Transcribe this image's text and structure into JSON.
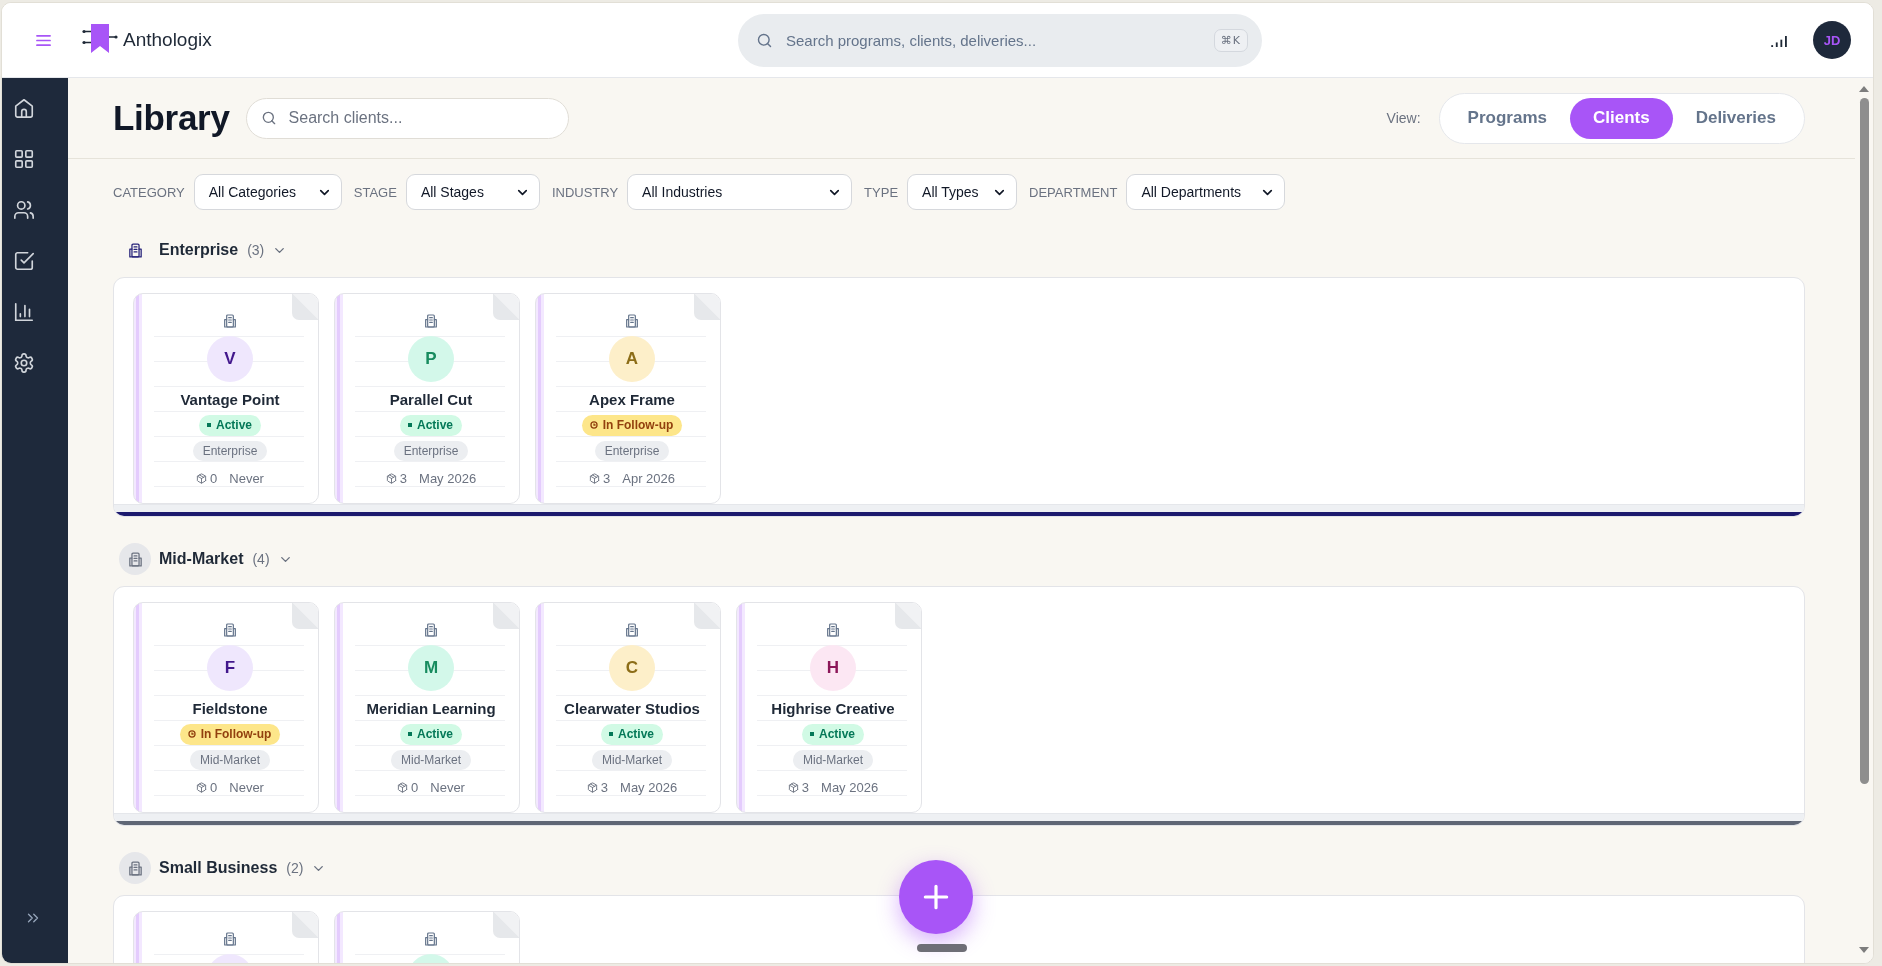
{
  "top_bar": {
    "brand": "Anthologix",
    "search": {
      "placeholder": "Search programs, clients, deliveries...",
      "shortcut": "⌘K"
    },
    "user": {
      "initials": "JD"
    }
  },
  "header": {
    "title": "Library",
    "search": {
      "placeholder": "Search clients..."
    },
    "view_label": "View:",
    "views": [
      {
        "label": "Programs",
        "selected": false
      },
      {
        "label": "Clients",
        "selected": true
      },
      {
        "label": "Deliveries",
        "selected": false
      }
    ]
  },
  "filters": [
    {
      "label": "CATEGORY",
      "value": "All Categories"
    },
    {
      "label": "STAGE",
      "value": "All Stages"
    },
    {
      "label": "INDUSTRY",
      "value": "All Industries"
    },
    {
      "label": "TYPE",
      "value": "All Types"
    },
    {
      "label": "DEPARTMENT",
      "value": "All Departments"
    }
  ],
  "groups": [
    {
      "name": "Enterprise",
      "count": "(3)",
      "selected": true,
      "expanded": true,
      "clients": [
        {
          "initial": "V",
          "color": "#efe7fd",
          "name": "Vantage Point",
          "status": {
            "label": "Active",
            "kind": "active"
          },
          "category": "Enterprise",
          "count": "0",
          "date": "Never"
        },
        {
          "initial": "P",
          "color": "#d3f8ea",
          "name": "Parallel Cut",
          "status": {
            "label": "Active",
            "kind": "active"
          },
          "category": "Enterprise",
          "count": "3",
          "date": "May 2026"
        },
        {
          "initial": "A",
          "color": "#fdefc9",
          "name": "Apex Frame",
          "status": {
            "label": "In Follow-up",
            "kind": "follow-up"
          },
          "category": "Enterprise",
          "count": "3",
          "date": "Apr 2026"
        }
      ]
    },
    {
      "name": "Mid-Market",
      "count": "(4)",
      "selected": false,
      "expanded": true,
      "clients": [
        {
          "initial": "F",
          "color": "#efe7fd",
          "name": "Fieldstone",
          "status": {
            "label": "In Follow-up",
            "kind": "follow-up"
          },
          "category": "Mid-Market",
          "count": "0",
          "date": "Never"
        },
        {
          "initial": "M",
          "color": "#d3f8ea",
          "name": "Meridian Learning",
          "status": {
            "label": "Active",
            "kind": "active"
          },
          "category": "Mid-Market",
          "count": "0",
          "date": "Never"
        },
        {
          "initial": "C",
          "color": "#fdefc9",
          "name": "Clearwater Studios",
          "status": {
            "label": "Active",
            "kind": "active"
          },
          "category": "Mid-Market",
          "count": "3",
          "date": "May 2026"
        },
        {
          "initial": "H",
          "color": "#fce7f3",
          "name": "Highrise Creative",
          "status": {
            "label": "Active",
            "kind": "active"
          },
          "category": "Mid-Market",
          "count": "3",
          "date": "May 2026"
        }
      ]
    },
    {
      "name": "Small Business",
      "count": "(2)",
      "selected": false,
      "expanded": true,
      "clients": [
        {
          "color": "#efe7fd"
        },
        {
          "color": "#d3f8ea"
        }
      ]
    }
  ]
}
